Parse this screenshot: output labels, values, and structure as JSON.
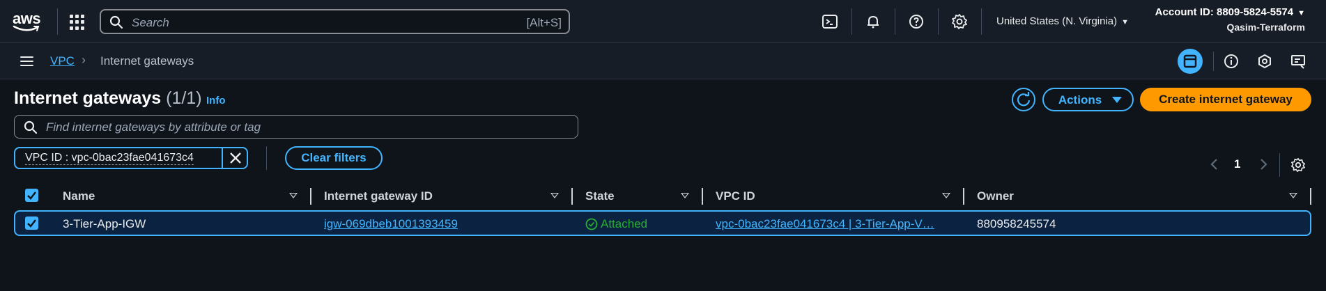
{
  "topnav": {
    "logo": "aws",
    "search_placeholder": "Search",
    "search_shortcut": "[Alt+S]",
    "icons": [
      "cloudshell-icon",
      "notifications-icon",
      "help-icon",
      "settings-icon"
    ],
    "region": "United States (N. Virginia)",
    "account_id": "Account ID: 8809-5824-5574",
    "account_name": "Qasim-Terraform"
  },
  "breadcrumb": {
    "service": "VPC",
    "current": "Internet gateways"
  },
  "page": {
    "title": "Internet gateways",
    "count": "(1/1)",
    "info": "Info",
    "actions_label": "Actions",
    "create_label": "Create internet gateway",
    "filter_placeholder": "Find internet gateways by attribute or tag",
    "filter_token": "VPC ID : vpc-0bac23fae041673c4",
    "clear_filters": "Clear filters",
    "page_number": "1"
  },
  "table": {
    "columns": [
      "Name",
      "Internet gateway ID",
      "State",
      "VPC ID",
      "Owner"
    ],
    "rows": [
      {
        "selected": true,
        "name": "3-Tier-App-IGW",
        "igw_id": "igw-069dbeb1001393459",
        "state": "Attached",
        "vpc_id": "vpc-0bac23fae041673c4 | 3-Tier-App-V…",
        "owner": "880958245574"
      }
    ]
  },
  "colors": {
    "accent": "#42b4ff",
    "primary_button": "#ff9900",
    "success": "#29ad32",
    "background": "#0f141a",
    "header": "#161d26"
  }
}
